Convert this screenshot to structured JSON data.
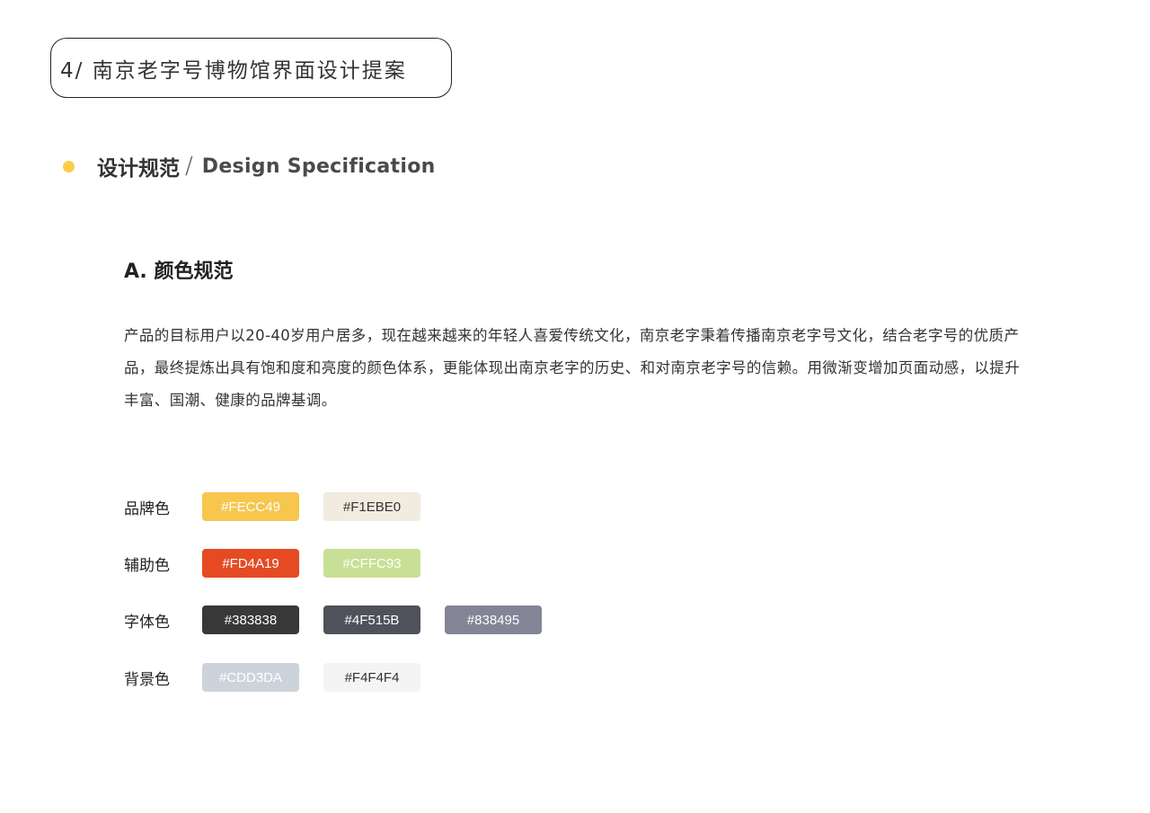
{
  "header": {
    "title": "4/ 南京老字号博物馆界面设计提案"
  },
  "section": {
    "title_cn": "设计规范",
    "slash": "/",
    "title_en": "Design Specification",
    "bullet_color": "#FECC49"
  },
  "subsection": {
    "title": "A. 颜色规范",
    "paragraph": "产品的目标用户以20-40岁用户居多，现在越来越来的年轻人喜爱传统文化，南京老字秉着传播南京老字号文化，结合老字号的优质产品，最终提炼出具有饱和度和亮度的颜色体系，更能体现出南京老字的历史、和对南京老字号的信赖。用微渐变增加页面动感，以提升丰富、国潮、健康的品牌基调。"
  },
  "palette": [
    {
      "label": "品牌色",
      "swatches": [
        {
          "text": "#FECC49",
          "bg": "#F6C64D",
          "fg": "#FFFFFF"
        },
        {
          "text": "#F1EBE0",
          "bg": "#F1EBE0",
          "fg": "#333333"
        }
      ]
    },
    {
      "label": "辅助色",
      "swatches": [
        {
          "text": "#FD4A19",
          "bg": "#E64A22",
          "fg": "#FFFFFF"
        },
        {
          "text": "#CFFC93",
          "bg": "#C8E095",
          "fg": "#FFFFFF"
        }
      ]
    },
    {
      "label": "字体色",
      "swatches": [
        {
          "text": "#383838",
          "bg": "#383838",
          "fg": "#FFFFFF"
        },
        {
          "text": "#4F515B",
          "bg": "#4F515B",
          "fg": "#FFFFFF"
        },
        {
          "text": "#838495",
          "bg": "#838495",
          "fg": "#FFFFFF"
        }
      ]
    },
    {
      "label": "背景色",
      "swatches": [
        {
          "text": "#CDD3DA",
          "bg": "#CDD3DA",
          "fg": "#FFFFFF"
        },
        {
          "text": "#F4F4F4",
          "bg": "#F4F4F4",
          "fg": "#333333"
        }
      ]
    }
  ]
}
